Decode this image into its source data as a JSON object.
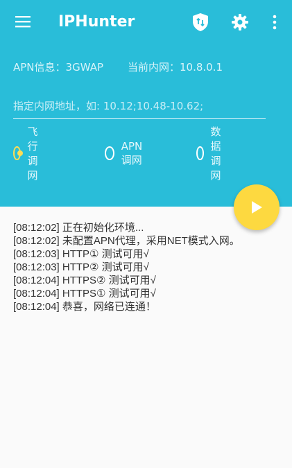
{
  "toolbar": {
    "title": "IPHunter"
  },
  "info": {
    "apn_label": "APN信息：3GWAP",
    "intranet_label": "当前内网：10.8.0.1"
  },
  "range_input": {
    "placeholder": "指定内网地址，如: 10.12;10.48-10.62;",
    "value": ""
  },
  "modes": [
    {
      "label": "飞行调网",
      "selected": true
    },
    {
      "label": "APN调网",
      "selected": false
    },
    {
      "label": "数据调网",
      "selected": false
    }
  ],
  "log": [
    "[08:12:02] 正在初始化环境...",
    "[08:12:02] 未配置APN代理，采用NET模式入网。",
    "[08:12:03] HTTP①  测试可用√",
    "[08:12:03] HTTP②  测试可用√",
    "[08:12:04] HTTPS② 测试可用√",
    "[08:12:04] HTTPS① 测试可用√",
    "[08:12:04] 恭喜，网络已连通！"
  ],
  "colors": {
    "header_bg": "#29bdd9",
    "accent": "#fdd940",
    "page_bg": "#fafafa"
  }
}
